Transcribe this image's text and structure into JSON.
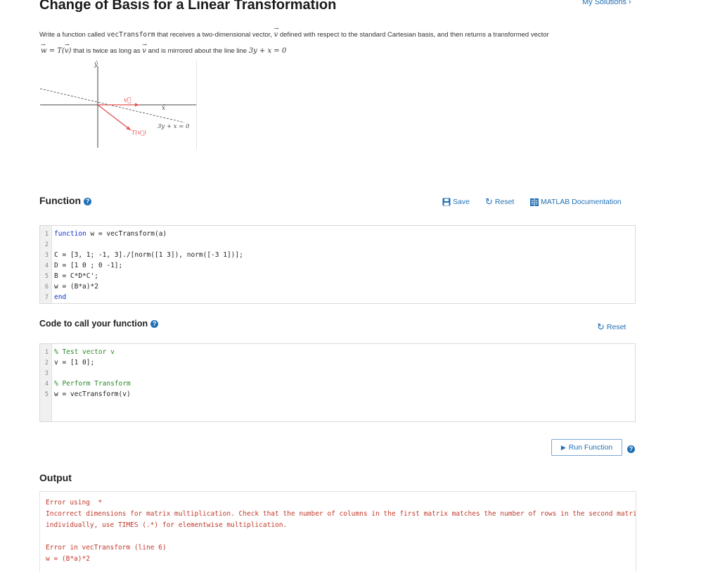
{
  "page": {
    "title": "Change of Basis for a Linear Transformation",
    "my_solutions": "My Solutions ›"
  },
  "description": {
    "line1_a": "Write a function called",
    "line1_code": "vecTransform",
    "line1_b": "that receives a two-dimensional vector,",
    "line1_v": "v",
    "line1_c": "defined with respect to the standard Cartesian basis, and then returns a transformed vector",
    "line2_w": "w",
    "line2_eq": " = T(",
    "line2_v": "v",
    "line2_close": ")",
    "line2_b": "that is twice as long as",
    "line2_v2": "v",
    "line2_c": "and is mirrored about the line line",
    "line2_eqn": "3y + x = 0"
  },
  "diagram": {
    "y_label": "ŷ",
    "x_label": "x̂",
    "v_label": "v⃗",
    "tv_label": "T(v⃗)",
    "line_label": "3y + x = 0",
    "colors": {
      "vector": "#e05050",
      "axis": "#444444",
      "line": "#444444"
    }
  },
  "function_section": {
    "heading": "Function",
    "help": "?",
    "save": "Save",
    "reset": "Reset",
    "docs": "MATLAB Documentation",
    "lines": [
      {
        "n": "1",
        "parts": [
          {
            "t": "function",
            "c": "kw"
          },
          {
            "t": " w = vecTransform(a)",
            "c": ""
          }
        ]
      },
      {
        "n": "2",
        "parts": [
          {
            "t": "",
            "c": ""
          }
        ]
      },
      {
        "n": "3",
        "parts": [
          {
            "t": "C = [3, 1; -1, 3]./[norm([1 3]), norm([-3 1])];",
            "c": ""
          }
        ]
      },
      {
        "n": "4",
        "parts": [
          {
            "t": "D = [1 0 ; 0 -1];",
            "c": ""
          }
        ]
      },
      {
        "n": "5",
        "parts": [
          {
            "t": "B = C*D*C';",
            "c": ""
          }
        ]
      },
      {
        "n": "6",
        "parts": [
          {
            "t": "w = (B*a)*2",
            "c": ""
          }
        ]
      },
      {
        "n": "7",
        "parts": [
          {
            "t": "end",
            "c": "kw"
          }
        ]
      }
    ]
  },
  "call_section": {
    "heading": "Code to call your function",
    "help": "?",
    "reset": "Reset",
    "lines": [
      {
        "n": "1",
        "parts": [
          {
            "t": "% Test vector v",
            "c": "cm"
          }
        ]
      },
      {
        "n": "2",
        "parts": [
          {
            "t": "v = [1 0];",
            "c": ""
          }
        ]
      },
      {
        "n": "3",
        "parts": [
          {
            "t": "",
            "c": ""
          }
        ]
      },
      {
        "n": "4",
        "parts": [
          {
            "t": "% Perform Transform",
            "c": "cm"
          }
        ]
      },
      {
        "n": "5",
        "parts": [
          {
            "t": "w = vecTransform(v)",
            "c": ""
          }
        ]
      }
    ]
  },
  "run": {
    "label": "Run Function",
    "help": "?"
  },
  "output": {
    "heading": "Output",
    "lines": [
      "Error using  *",
      "Incorrect dimensions for matrix multiplication. Check that the number of columns in the first matrix matches the number of rows in the second matrix. To perform elementwise multiplication, use '.*'.",
      "individually, use TIMES (.*) for elementwise multiplication.",
      "",
      "Error in vecTransform (line 6)",
      "w = (B*a)*2"
    ]
  }
}
